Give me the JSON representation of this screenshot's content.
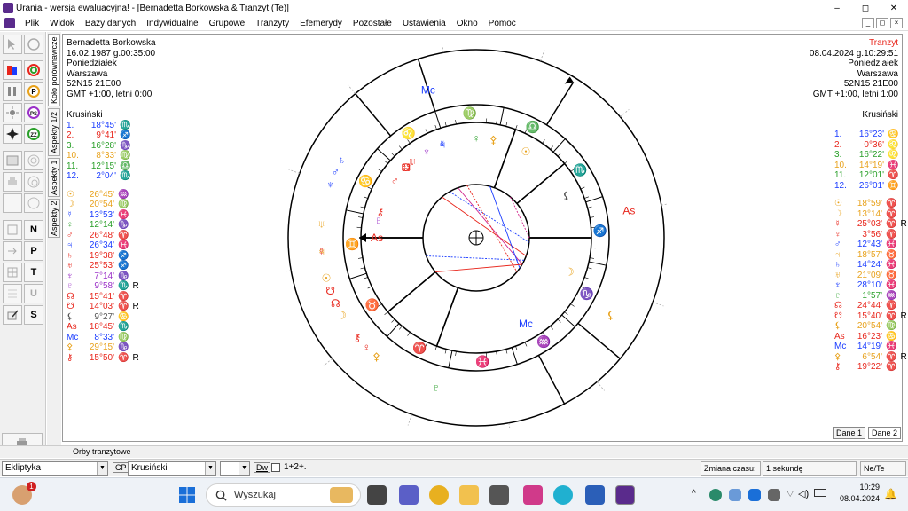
{
  "window": {
    "title": "Urania - wersja ewaluacyjna! - [Bernadetta Borkowska & Tranzyt (Te)]",
    "min": "–",
    "max": "◻",
    "close": "✕"
  },
  "menu": [
    "Plik",
    "Widok",
    "Bazy danych",
    "Indywidualne",
    "Grupowe",
    "Tranzyty",
    "Efemerydy",
    "Pozostałe",
    "Ustawienia",
    "Okno",
    "Pomoc"
  ],
  "mdi": {
    "min": "_",
    "restore": "◻",
    "close": "×"
  },
  "toolbar": {
    "n_label": "N",
    "p_label": "P",
    "t_label": "T",
    "u_label": "U",
    "s_label": "S"
  },
  "vtabs": [
    "Koło porównawcze",
    "Aspekty 1/2",
    "Aspekty 1",
    "Aspekty 2"
  ],
  "left_info": {
    "name": "Bernadetta Borkowska",
    "date": "16.02.1987 g.00:35:00",
    "day": "Poniedziałek",
    "city": "Warszawa",
    "coords": "52N15  21E00",
    "tz": "GMT +1:00, letni 0:00",
    "house_system": "Krusiński",
    "houses": [
      {
        "num": "1.",
        "deg": "18°45'",
        "sign": "♏",
        "color": "#1a3cff"
      },
      {
        "num": "2.",
        "deg": "9°41'",
        "sign": "♐",
        "color": "#e8261c"
      },
      {
        "num": "3.",
        "deg": "16°28'",
        "sign": "♑",
        "color": "#2aa02a"
      },
      {
        "num": "10.",
        "deg": "8°33'",
        "sign": "♍",
        "color": "#e8a21c"
      },
      {
        "num": "11.",
        "deg": "12°15'",
        "sign": "♎",
        "color": "#2aa02a"
      },
      {
        "num": "12.",
        "deg": "2°04'",
        "sign": "♏",
        "color": "#1a3cff"
      }
    ],
    "planets": [
      {
        "glyph": "☉",
        "deg": "26°45'",
        "sign": "♒",
        "retro": "",
        "color": "#e8a21c"
      },
      {
        "glyph": "☽",
        "deg": "20°54'",
        "sign": "♍",
        "retro": "",
        "color": "#e8a21c"
      },
      {
        "glyph": "☿",
        "deg": "13°53'",
        "sign": "♓",
        "retro": "",
        "color": "#1a3cff"
      },
      {
        "glyph": "♀",
        "deg": "12°14'",
        "sign": "♑",
        "retro": "",
        "color": "#2aa02a"
      },
      {
        "glyph": "♂",
        "deg": "26°48'",
        "sign": "♈",
        "retro": "",
        "color": "#e8261c"
      },
      {
        "glyph": "♃",
        "deg": "26°34'",
        "sign": "♓",
        "retro": "",
        "color": "#1a3cff"
      },
      {
        "glyph": "♄",
        "deg": "19°38'",
        "sign": "♐",
        "retro": "",
        "color": "#e8261c"
      },
      {
        "glyph": "♅",
        "deg": "25°53'",
        "sign": "♐",
        "retro": "",
        "color": "#e8261c"
      },
      {
        "glyph": "♆",
        "deg": "7°14'",
        "sign": "♑",
        "retro": "",
        "color": "#9b30c8"
      },
      {
        "glyph": "♇",
        "deg": "9°58'",
        "sign": "♏",
        "retro": "R",
        "color": "#9b30c8"
      },
      {
        "glyph": "☊",
        "deg": "15°41'",
        "sign": "♈",
        "retro": "",
        "color": "#e8261c"
      },
      {
        "glyph": "☋",
        "deg": "14°03'",
        "sign": "♈",
        "retro": "R",
        "color": "#e8261c"
      },
      {
        "glyph": "⚸",
        "deg": "9°27'",
        "sign": "♋",
        "retro": "",
        "color": "#555555"
      },
      {
        "glyph": "As",
        "deg": "18°45'",
        "sign": "♏",
        "retro": "",
        "color": "#e8261c"
      },
      {
        "glyph": "Mc",
        "deg": "8°33'",
        "sign": "♍",
        "retro": "",
        "color": "#1a3cff"
      },
      {
        "glyph": "⚴",
        "deg": "29°15'",
        "sign": "♑",
        "retro": "",
        "color": "#e8a21c"
      },
      {
        "glyph": "⚷",
        "deg": "15°50'",
        "sign": "♈",
        "retro": "R",
        "color": "#e8261c"
      }
    ]
  },
  "right_info": {
    "name": "Tranzyt",
    "date": "08.04.2024 g.10:29:51",
    "day": "Poniedziałek",
    "city": "Warszawa",
    "coords": "52N15  21E00",
    "tz": "GMT +1:00, letni 1:00",
    "house_system": "Krusiński",
    "houses": [
      {
        "num": "1.",
        "deg": "16°23'",
        "sign": "♋",
        "color": "#1a3cff"
      },
      {
        "num": "2.",
        "deg": "0°36'",
        "sign": "♌",
        "color": "#e8261c"
      },
      {
        "num": "3.",
        "deg": "16°22'",
        "sign": "♌",
        "color": "#2aa02a"
      },
      {
        "num": "10.",
        "deg": "14°19'",
        "sign": "♓",
        "color": "#e8a21c"
      },
      {
        "num": "11.",
        "deg": "12°01'",
        "sign": "♈",
        "color": "#2aa02a"
      },
      {
        "num": "12.",
        "deg": "26°01'",
        "sign": "♊",
        "color": "#1a3cff"
      }
    ],
    "planets": [
      {
        "glyph": "☉",
        "deg": "18°59'",
        "sign": "♈",
        "retro": "",
        "color": "#e8a21c"
      },
      {
        "glyph": "☽",
        "deg": "13°14'",
        "sign": "♈",
        "retro": "",
        "color": "#e8a21c"
      },
      {
        "glyph": "☿",
        "deg": "25°03'",
        "sign": "♈",
        "retro": "R",
        "color": "#e8261c"
      },
      {
        "glyph": "♀",
        "deg": "3°56'",
        "sign": "♈",
        "retro": "",
        "color": "#e8261c"
      },
      {
        "glyph": "♂",
        "deg": "12°43'",
        "sign": "♓",
        "retro": "",
        "color": "#1a3cff"
      },
      {
        "glyph": "♃",
        "deg": "18°57'",
        "sign": "♉",
        "retro": "",
        "color": "#e8a21c"
      },
      {
        "glyph": "♄",
        "deg": "14°24'",
        "sign": "♓",
        "retro": "",
        "color": "#1a3cff"
      },
      {
        "glyph": "♅",
        "deg": "21°09'",
        "sign": "♉",
        "retro": "",
        "color": "#e8a21c"
      },
      {
        "glyph": "♆",
        "deg": "28°10'",
        "sign": "♓",
        "retro": "",
        "color": "#1a3cff"
      },
      {
        "glyph": "♇",
        "deg": "1°57'",
        "sign": "♒",
        "retro": "",
        "color": "#2aa02a"
      },
      {
        "glyph": "☊",
        "deg": "24°44'",
        "sign": "♈",
        "retro": "",
        "color": "#e8261c"
      },
      {
        "glyph": "☋",
        "deg": "15°40'",
        "sign": "♈",
        "retro": "R",
        "color": "#e8261c"
      },
      {
        "glyph": "⚸",
        "deg": "20°54'",
        "sign": "♍",
        "retro": "",
        "color": "#e8a21c"
      },
      {
        "glyph": "As",
        "deg": "16°23'",
        "sign": "♋",
        "retro": "",
        "color": "#e8261c"
      },
      {
        "glyph": "Mc",
        "deg": "14°19'",
        "sign": "♓",
        "retro": "",
        "color": "#1a3cff"
      },
      {
        "glyph": "⚴",
        "deg": "6°54'",
        "sign": "♈",
        "retro": "R",
        "color": "#e8a21c"
      },
      {
        "glyph": "⚷",
        "deg": "19°22'",
        "sign": "♈",
        "retro": "",
        "color": "#e8261c"
      }
    ]
  },
  "wheel": {
    "signs": [
      {
        "glyph": "♍",
        "color": "#e8a21c"
      },
      {
        "glyph": "♌",
        "color": "#e8261c"
      },
      {
        "glyph": "♋",
        "color": "#1a3cff"
      },
      {
        "glyph": "♊",
        "color": "#2aa02a"
      },
      {
        "glyph": "♉",
        "color": "#e8a21c"
      },
      {
        "glyph": "♈",
        "color": "#e8261c"
      },
      {
        "glyph": "♓",
        "color": "#1a3cff"
      },
      {
        "glyph": "♒",
        "color": "#2aa02a"
      },
      {
        "glyph": "♑",
        "color": "#e8a21c"
      },
      {
        "glyph": "♐",
        "color": "#e8261c"
      },
      {
        "glyph": "♏",
        "color": "#1a3cff"
      },
      {
        "glyph": "♎",
        "color": "#2aa02a"
      }
    ]
  },
  "data_tabs": [
    "Dane 1",
    "Dane 2"
  ],
  "status": {
    "orb_label": "Orby tranzytowe",
    "ecliptic": "Ekliptyka",
    "cp_label": "CP",
    "house_combo": "Krusiński",
    "dw_label": "Dw",
    "aspect_label": "1+2+.",
    "zmiana_label": "Zmiana czasu:",
    "zmiana_value": "1 sekundę",
    "nete": "Ne/Te"
  },
  "taskbar": {
    "search_placeholder": "Wyszukaj",
    "time": "10:29",
    "date": "08.04.2024",
    "badge": "1"
  }
}
